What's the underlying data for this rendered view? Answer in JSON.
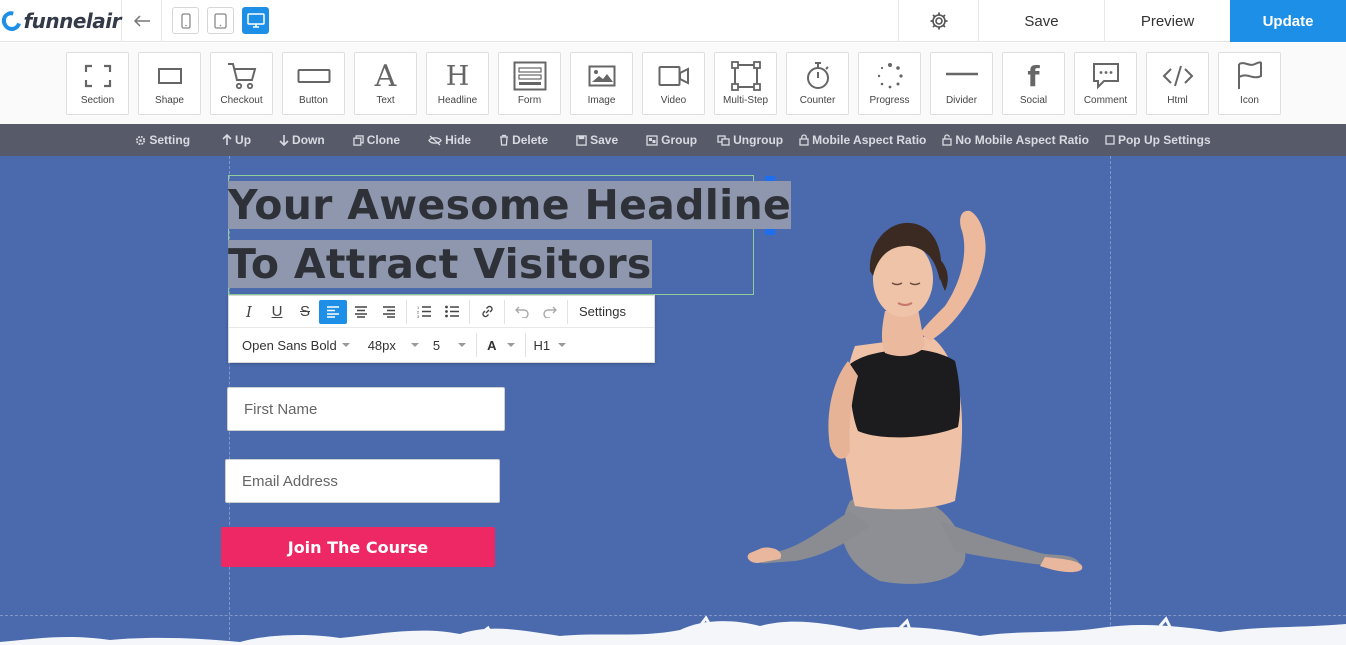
{
  "app": {
    "logo_text": "funnelair",
    "brand_color": "#1e8fe6"
  },
  "topbar": {
    "save_label": "Save",
    "preview_label": "Preview",
    "update_label": "Update"
  },
  "palette": [
    {
      "label": "Section",
      "icon": "section-icon"
    },
    {
      "label": "Shape",
      "icon": "shape-icon"
    },
    {
      "label": "Checkout",
      "icon": "cart-icon"
    },
    {
      "label": "Button",
      "icon": "button-icon"
    },
    {
      "label": "Text",
      "icon": "text-icon"
    },
    {
      "label": "Headline",
      "icon": "headline-icon"
    },
    {
      "label": "Form",
      "icon": "form-icon"
    },
    {
      "label": "Image",
      "icon": "image-icon"
    },
    {
      "label": "Video",
      "icon": "video-icon"
    },
    {
      "label": "Multi-Step",
      "icon": "multistep-icon"
    },
    {
      "label": "Counter",
      "icon": "stopwatch-icon"
    },
    {
      "label": "Progress",
      "icon": "progress-icon"
    },
    {
      "label": "Divider",
      "icon": "divider-icon"
    },
    {
      "label": "Social",
      "icon": "facebook-icon"
    },
    {
      "label": "Comment",
      "icon": "comment-icon"
    },
    {
      "label": "Html",
      "icon": "code-icon"
    },
    {
      "label": "Icon",
      "icon": "flag-icon"
    }
  ],
  "element_toolbar": [
    {
      "label": "Setting",
      "icon": "gear-icon"
    },
    {
      "label": "Up",
      "icon": "arrow-up-icon"
    },
    {
      "label": "Down",
      "icon": "arrow-down-icon"
    },
    {
      "label": "Clone",
      "icon": "clone-icon"
    },
    {
      "label": "Hide",
      "icon": "eye-slash-icon"
    },
    {
      "label": "Delete",
      "icon": "trash-icon"
    },
    {
      "label": "Save",
      "icon": "floppy-icon"
    },
    {
      "label": "Group",
      "icon": "group-icon"
    },
    {
      "label": "Ungroup",
      "icon": "ungroup-icon"
    },
    {
      "label": "Mobile Aspect Ratio",
      "icon": "lock-icon"
    },
    {
      "label": "No Mobile Aspect Ratio",
      "icon": "unlock-icon"
    },
    {
      "label": "Pop Up Settings",
      "icon": "square-icon"
    }
  ],
  "canvas": {
    "headline_line1": "Your Awesome Headline",
    "headline_line2": "To Attract Visitors",
    "first_name_placeholder": "First Name",
    "email_placeholder": "Email Address",
    "cta_label": "Join The Course",
    "background_color": "#4a6aad",
    "cta_color": "#ee2865"
  },
  "rich_text_editor": {
    "settings_label": "Settings",
    "font_family": "Open Sans Bold",
    "font_size": "48px",
    "line_height": "5",
    "color_label": "A",
    "heading_level": "H1"
  }
}
